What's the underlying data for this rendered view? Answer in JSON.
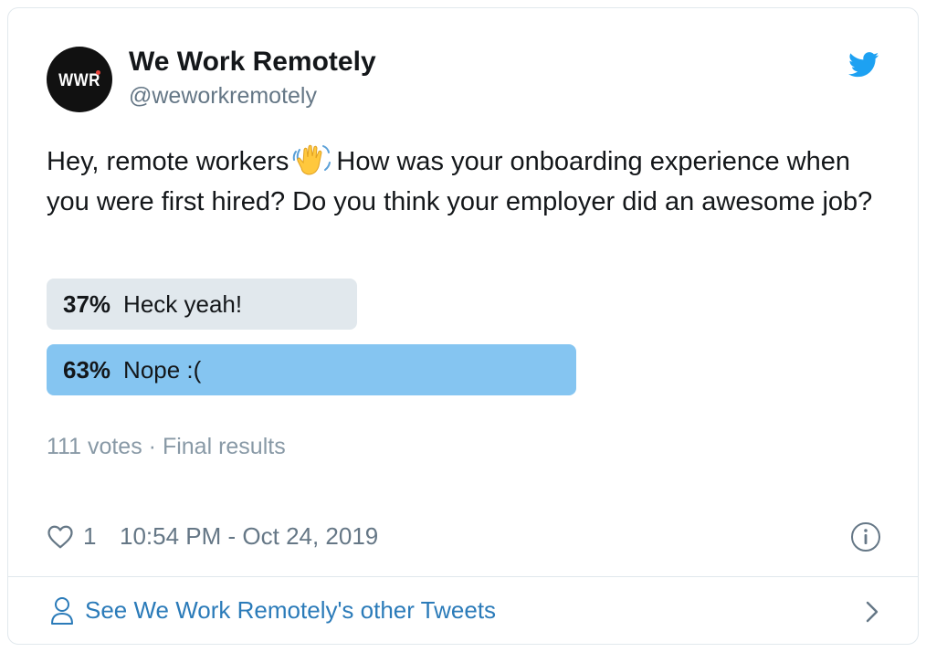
{
  "account": {
    "avatar_text": "WWR",
    "name": "We Work Remotely",
    "handle": "@weworkremotely"
  },
  "icons": {
    "brand": "twitter-bird-icon",
    "emoji": "waving-hand-emoji",
    "like": "heart-icon",
    "info": "info-icon",
    "profile": "person-icon",
    "chevron": "chevron-right-icon"
  },
  "tweet": {
    "text_before": "Hey, remote workers",
    "text_after": "How was your onboarding experience when you were first hired? Do you think your employer did an awesome job?"
  },
  "poll": {
    "options": [
      {
        "percent_label": "37%",
        "label": "Heck yeah!",
        "fraction": 0.37
      },
      {
        "percent_label": "63%",
        "label": "Nope :(",
        "fraction": 0.63
      }
    ],
    "votes": "111 votes",
    "separator": "·",
    "status": "Final results"
  },
  "footer": {
    "likes": "1",
    "timestamp": "10:54 PM - Oct 24, 2019"
  },
  "see_more": {
    "label": "See We Work Remotely's other Tweets"
  },
  "colors": {
    "accent": "#1da1f2",
    "link": "#2b7bb9",
    "winning_bar": "#85c5f1",
    "losing_bar": "#e1e8ed",
    "muted": "#657786"
  }
}
